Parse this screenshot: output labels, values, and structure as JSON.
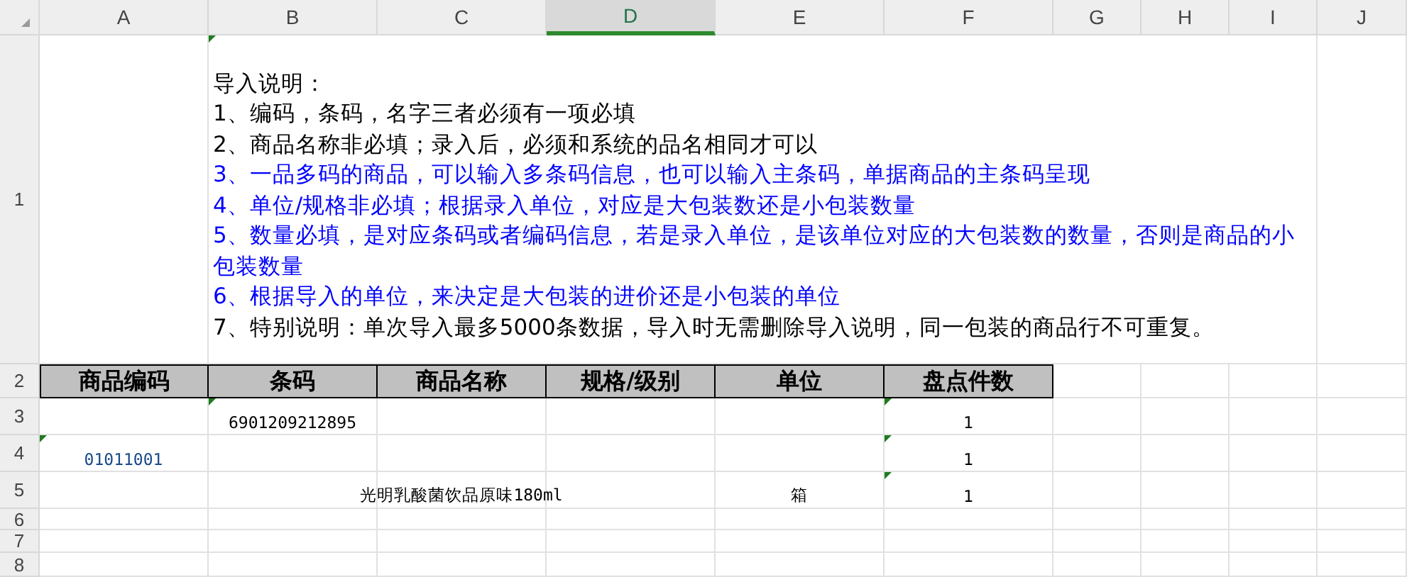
{
  "columns": [
    {
      "label": "A",
      "selected": false
    },
    {
      "label": "B",
      "selected": false
    },
    {
      "label": "C",
      "selected": false
    },
    {
      "label": "D",
      "selected": true
    },
    {
      "label": "E",
      "selected": false
    },
    {
      "label": "F",
      "selected": false
    },
    {
      "label": "G",
      "selected": false
    },
    {
      "label": "H",
      "selected": false
    },
    {
      "label": "I",
      "selected": false
    },
    {
      "label": "J",
      "selected": false
    }
  ],
  "instructions": {
    "row_label": "1",
    "warning": true,
    "lines": [
      {
        "text": "导入说明：",
        "color": "#000000"
      },
      {
        "text": "1、编码，条码，名字三者必须有一项必填",
        "color": "#000000"
      },
      {
        "text": "2、商品名称非必填；录入后，必须和系统的品名相同才可以",
        "color": "#000000"
      },
      {
        "text": "3、一品多码的商品，可以输入多条码信息，也可以输入主条码，单据商品的主条码呈现",
        "color": "#0000ff"
      },
      {
        "text": "4、单位/规格非必填；根据录入单位，对应是大包装数还是小包装数量",
        "color": "#0000ff"
      },
      {
        "text": "5、数量必填，是对应条码或者编码信息，若是录入单位，是该单位对应的大包装数的数量，否则是商品的小包装数量",
        "color": "#0000ff"
      },
      {
        "text": "6、根据导入的单位，来决定是大包装的进价还是小包装的单位",
        "color": "#0000ff"
      },
      {
        "text": "7、特别说明：单次导入最多5000条数据，导入时无需删除导入说明，同一包装的商品行不可重复。",
        "color": "#000000"
      }
    ]
  },
  "header_row": {
    "row_label": "2",
    "cells": [
      "商品编码",
      "条码",
      "商品名称",
      "规格/级别",
      "单位",
      "盘点件数"
    ]
  },
  "data_rows": [
    {
      "row_label": "3",
      "cells": [
        {},
        {
          "value": "6901209212895",
          "warning": true
        },
        {},
        {},
        {},
        {
          "value": "1",
          "warning": true
        }
      ]
    },
    {
      "row_label": "4",
      "cells": [
        {
          "value": "01011001",
          "warning": true
        },
        {},
        {},
        {},
        {},
        {
          "value": "1",
          "warning": true
        }
      ]
    },
    {
      "row_label": "5",
      "cells": [
        {},
        {},
        {
          "value": "光明乳酸菌饮品原味180ml",
          "warning": false
        },
        {},
        {
          "value": "箱",
          "warning": false
        },
        {
          "value": "1",
          "warning": true
        }
      ]
    },
    {
      "row_label": "6",
      "cells": []
    },
    {
      "row_label": "7",
      "cells": []
    },
    {
      "row_label": "8",
      "cells": []
    }
  ]
}
